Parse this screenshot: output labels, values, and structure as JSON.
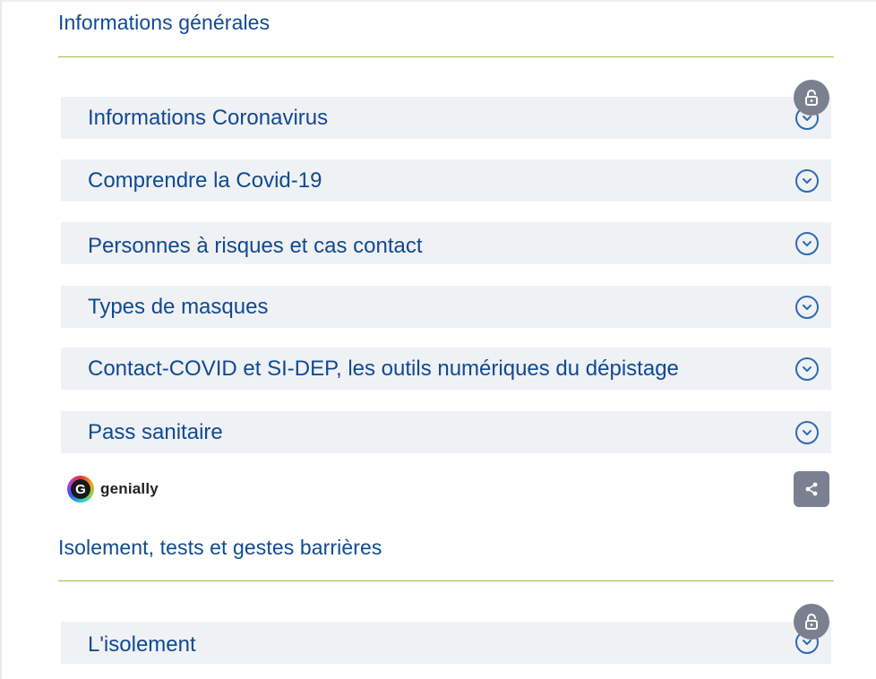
{
  "sections": [
    {
      "title": "Informations générales",
      "items": [
        {
          "label": "Informations Coronavirus"
        },
        {
          "label": "Comprendre la Covid-19"
        },
        {
          "label": "Personnes à risques et cas contact"
        },
        {
          "label": "Types de masques"
        },
        {
          "label": "Contact-COVID et SI-DEP, les outils numériques du dépistage"
        },
        {
          "label": "Pass sanitaire"
        }
      ]
    },
    {
      "title": "Isolement, tests et gestes barrières",
      "items": [
        {
          "label": "L'isolement"
        }
      ]
    }
  ],
  "embed": {
    "brand": "genially",
    "logo_letter": "G",
    "share_icon": "share-icon",
    "lock_icon": "unlock-icon"
  },
  "colors": {
    "title": "#0f4a92",
    "rule": "#9bbd45",
    "item_background": "#f0f1f5",
    "button_gray": "#7b8091"
  }
}
